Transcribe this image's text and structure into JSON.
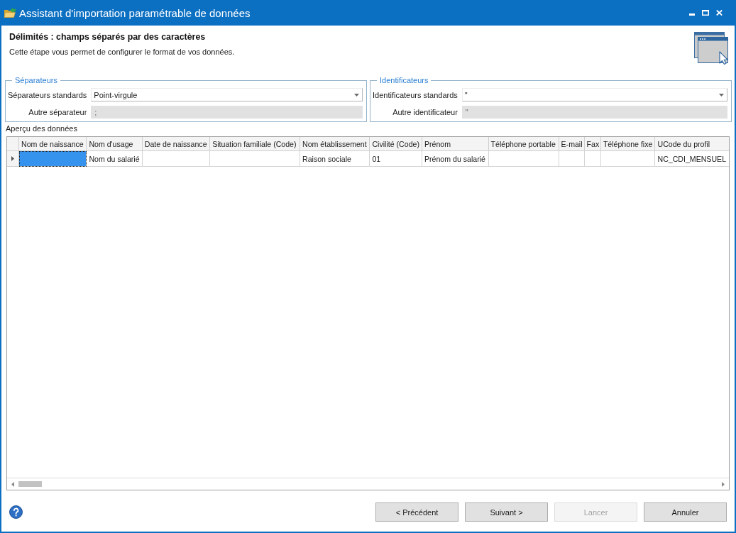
{
  "window": {
    "title": "Assistant d'importation paramétrable de données"
  },
  "header": {
    "title": "Délimités : champs séparés par des caractères",
    "subtitle": "Cette étape vous permet de configurer le format de vos données."
  },
  "groups": [
    {
      "legend": "Séparateurs",
      "fields": [
        {
          "kind": "combo",
          "label": "Séparateurs standards",
          "value": "Point-virgule",
          "disabled": false
        },
        {
          "kind": "text",
          "label": "Autre séparateur",
          "value": ";",
          "disabled": true
        }
      ]
    },
    {
      "legend": "Identificateurs",
      "fields": [
        {
          "kind": "combo",
          "label": "Identificateurs standards",
          "value": "\"",
          "disabled": false
        },
        {
          "kind": "text",
          "label": "Autre identificateur",
          "value": "\"",
          "disabled": true
        }
      ]
    }
  ],
  "preview": {
    "label": "Aperçu des données",
    "table": {
      "columns": [
        "Nom de naissance",
        "Nom d'usage",
        "Date de naissance",
        "Situation familiale (Code)",
        "Nom établissement",
        "Civilité (Code)",
        "Prénom",
        "Téléphone portable",
        "E-mail",
        "Fax",
        "Téléphone fixe",
        "UCode du profil"
      ],
      "rows": [
        {
          "current": true,
          "cells": [
            {
              "selected": true
            },
            {
              "text": "Nom du salarié",
              "selected": false
            },
            {
              "selected": false
            },
            {
              "selected": false
            },
            {
              "text": "Raison sociale",
              "selected": false
            },
            {
              "text": "01",
              "selected": false
            },
            {
              "text": "Prénom du salarié",
              "selected": false
            },
            {
              "selected": false
            },
            {
              "selected": false
            },
            {
              "selected": false
            },
            {
              "selected": false
            },
            {
              "text": "NC_CDI_MENSUEL",
              "selected": false
            }
          ]
        }
      ]
    }
  },
  "buttons": [
    {
      "label": "< Précédent",
      "disabled": false
    },
    {
      "label": "Suivant >",
      "disabled": false
    },
    {
      "label": "Lancer",
      "disabled": true
    },
    {
      "label": "Annuler",
      "disabled": false
    }
  ]
}
